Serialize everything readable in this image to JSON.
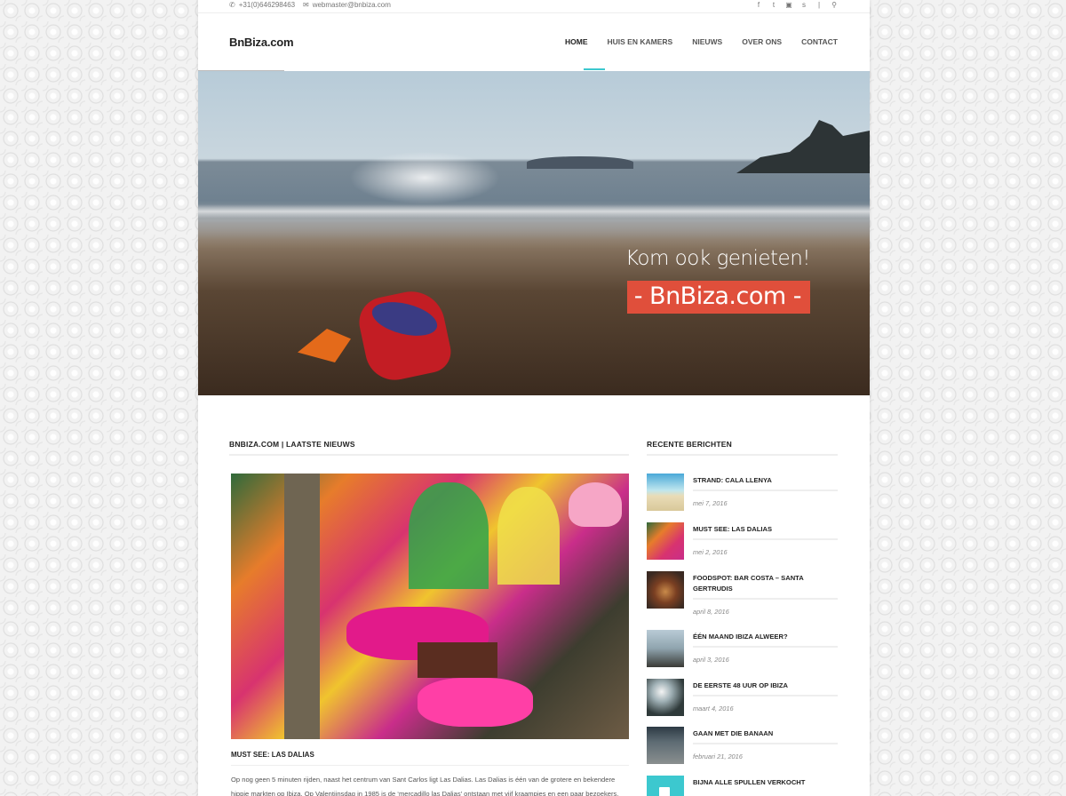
{
  "topbar": {
    "phone": "+31(0)646298463",
    "email": "webmaster@bnbiza.com",
    "social_icons": [
      "facebook-icon",
      "twitter-icon",
      "instagram-icon",
      "skype-icon",
      "divider",
      "search-icon"
    ]
  },
  "header": {
    "logo": "BnBiza.com",
    "nav": [
      "HOME",
      "HUIS EN KAMERS",
      "NIEUWS",
      "OVER ONS",
      "CONTACT"
    ],
    "active_nav": "HOME",
    "accent": "#3cc8cf"
  },
  "hero": {
    "line1": "Kom ook genieten!",
    "line2": "- BnBiza.com -",
    "badge_color": "#e04f3b"
  },
  "main": {
    "section_title": "BNBIZA.COM | LAATSTE NIEUWS",
    "post": {
      "title": "MUST SEE: LAS DALIAS",
      "excerpt": "Op nog geen 5 minuten rijden, naast het centrum van Sant Carlos ligt Las Dalias. Las Dalias is één van de grotere en bekendere hippie markten op Ibiza. Op Valentijnsdag in 1985 is de ‘mercadillo las Dalias’ ontstaan met vijf kraampjes en een paar bezoekers."
    }
  },
  "sidebar": {
    "title": "RECENTE BERICHTEN",
    "posts": [
      {
        "title": "STRAND: CALA LLENYA",
        "date": "mei 7, 2016",
        "thumb": "#5fb7c9"
      },
      {
        "title": "MUST SEE: LAS DALIAS",
        "date": "mei 2, 2016",
        "thumb": "#d83a7c"
      },
      {
        "title": "FOODSPOT: BAR COSTA – SANTA GERTRUDIS",
        "date": "april 8, 2016",
        "thumb": "#7a5a3f"
      },
      {
        "title": "ÉÉN MAAND IBIZA ALWEER?",
        "date": "april 3, 2016",
        "thumb": "#8fa0a8"
      },
      {
        "title": "DE EERSTE 48 UUR OP IBIZA",
        "date": "maart 4, 2016",
        "thumb": "#3c4548"
      },
      {
        "title": "GAAN MET DIE BANAAN",
        "date": "februari 21, 2016",
        "thumb": "#5d6b73"
      },
      {
        "title": "BIJNA ALLE SPULLEN VERKOCHT",
        "date": "",
        "thumb": "#3cc8cf"
      }
    ]
  }
}
